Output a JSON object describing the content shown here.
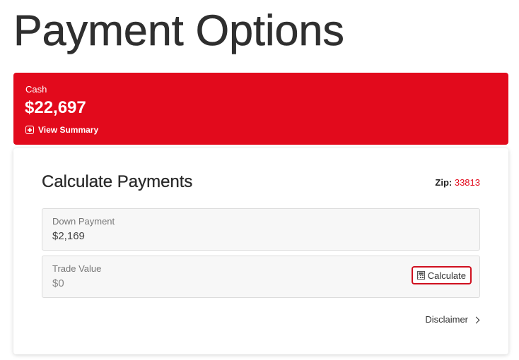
{
  "page": {
    "title": "Payment Options"
  },
  "cash": {
    "label": "Cash",
    "amount": "$22,697",
    "view_summary_label": "View Summary"
  },
  "calculator": {
    "title": "Calculate Payments",
    "zip_label": "Zip:",
    "zip_value": "33813",
    "down_payment": {
      "label": "Down Payment",
      "value": "$2,169"
    },
    "trade_value": {
      "label": "Trade Value",
      "value": "$0",
      "button_label": "Calculate"
    },
    "disclaimer_label": "Disclaimer"
  },
  "colors": {
    "brand_red": "#e20a1c"
  },
  "icons": {
    "view_summary": "plus-square-icon",
    "calculate": "calculator-icon",
    "disclaimer": "chevron-right-icon"
  }
}
